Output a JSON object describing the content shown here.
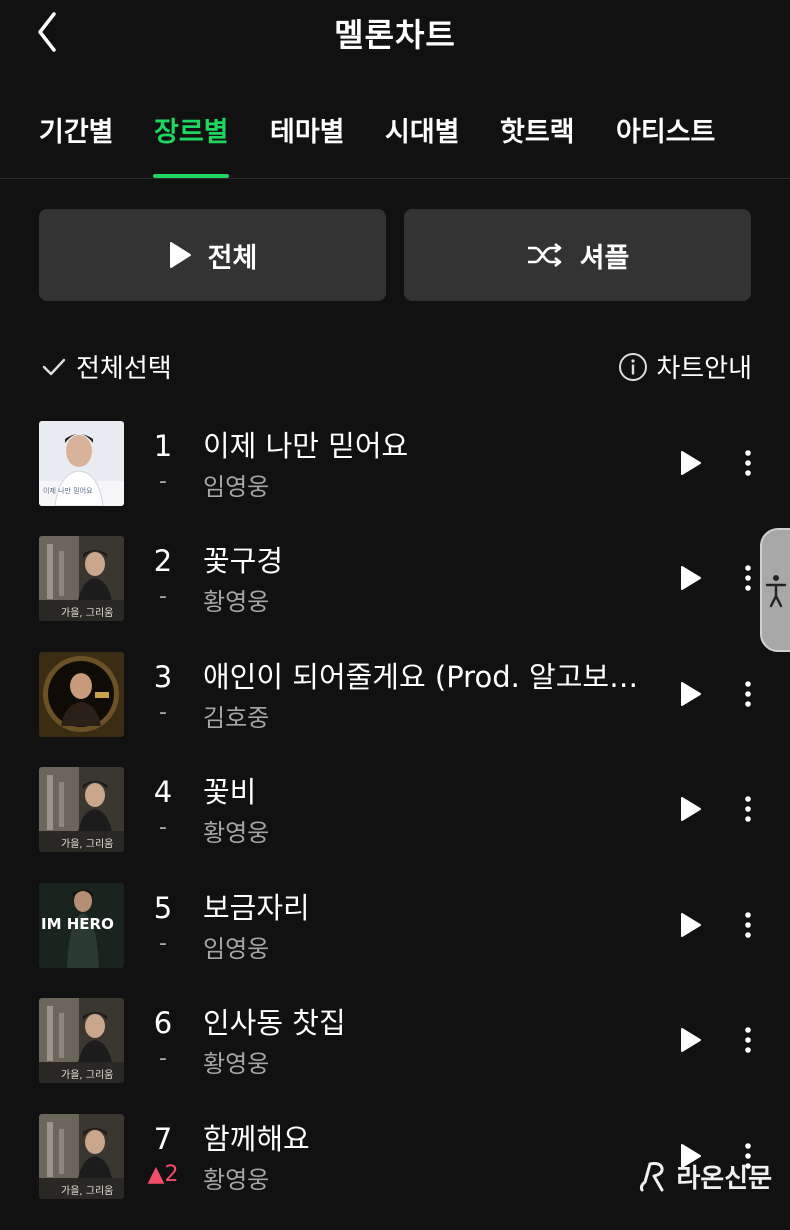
{
  "header": {
    "title": "멜론차트",
    "back_icon": "chevron-left-icon"
  },
  "tabs": [
    {
      "label": "기간별"
    },
    {
      "label": "장르별",
      "active": true
    },
    {
      "label": "테마별"
    },
    {
      "label": "시대별"
    },
    {
      "label": "핫트랙"
    },
    {
      "label": "아티스트"
    }
  ],
  "actions": {
    "play_all_label": "전체",
    "shuffle_label": "셔플"
  },
  "selection": {
    "select_all_label": "전체선택",
    "chart_guide_label": "차트안내"
  },
  "songs": [
    {
      "rank": "1",
      "change": "-",
      "title": "이제 나만 믿어요",
      "artist": "임영웅"
    },
    {
      "rank": "2",
      "change": "-",
      "title": "꽃구경",
      "artist": "황영웅"
    },
    {
      "rank": "3",
      "change": "-",
      "title": "애인이 되어줄게요 (Prod. 알고보니,...",
      "artist": "김호중"
    },
    {
      "rank": "4",
      "change": "-",
      "title": "꽃비",
      "artist": "황영웅"
    },
    {
      "rank": "5",
      "change": "-",
      "title": "보금자리",
      "artist": "임영웅"
    },
    {
      "rank": "6",
      "change": "-",
      "title": "인사동 찻집",
      "artist": "황영웅"
    },
    {
      "rank": "7",
      "change": "▲2",
      "title": "함께해요",
      "artist": "황영웅"
    }
  ],
  "covers": {
    "c1_caption": "이제 나만 믿어요",
    "c2_caption": "가을, 그리움",
    "c5_caption": "IM HERO"
  },
  "watermark": {
    "text": "라온신문"
  },
  "colors": {
    "accent": "#1ed760",
    "rank_up": "#f04e6b",
    "background": "#111111",
    "button": "#333333"
  }
}
